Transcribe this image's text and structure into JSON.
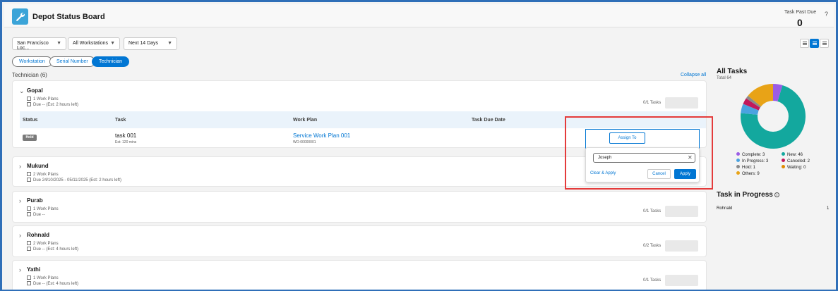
{
  "header": {
    "title": "Depot Status Board",
    "past_due_label": "Task Past Due",
    "past_due_value": "0",
    "help": "?"
  },
  "filters": {
    "location": "San Francisco Loc...",
    "workstation": "All Workstations",
    "range": "Next 14 Days"
  },
  "group_by": [
    {
      "label": "Workstation",
      "active": false
    },
    {
      "label": "Serial Number",
      "active": false
    },
    {
      "label": "Technician",
      "active": true
    }
  ],
  "group_title": "Technician (6)",
  "collapse_all": "Collapse all",
  "technicians": [
    {
      "name": "Gopal",
      "plans": "1 Work Plans",
      "due": "Due -- (Est: 2 hours left)",
      "tasks": "0/1 Tasks"
    },
    {
      "name": "Mukund",
      "plans": "2 Work Plans",
      "due": "Due 24/10/2025 - 05/11/2025 (Est: 2 hours left)",
      "tasks": ""
    },
    {
      "name": "Purab",
      "plans": "1 Work Plans",
      "due": "Due --",
      "tasks": "0/1 Tasks"
    },
    {
      "name": "Rohnald",
      "plans": "2 Work Plans",
      "due": "Due -- (Est: 4 hours left)",
      "tasks": "0/2 Tasks"
    },
    {
      "name": "Yathi",
      "plans": "1 Work Plans",
      "due": "Due -- (Est: 4 hours left)",
      "tasks": "0/1 Tasks"
    }
  ],
  "table": {
    "headers": {
      "status": "Status",
      "task": "Task",
      "work_plan": "Work Plan",
      "due_date": "Task Due Date"
    },
    "row": {
      "status": "Hold",
      "task": "task 001",
      "est": "Est: 120 mins",
      "work_plan": "Service Work Plan 001",
      "work_plan_id": "WO-00000001"
    }
  },
  "assign": {
    "button": "Assign To",
    "input_value": "Joseph",
    "clear_apply": "Clear & Apply",
    "cancel": "Cancel",
    "apply": "Apply"
  },
  "all_tasks": {
    "title": "All Tasks",
    "total": "Total 64",
    "legend": [
      {
        "label": "Complete: 3",
        "color": "#9b5de5"
      },
      {
        "label": "New: 46",
        "color": "#13a89e"
      },
      {
        "label": "In Progress: 3",
        "color": "#4aa3e0"
      },
      {
        "label": "Canceled: 2",
        "color": "#c2185b"
      },
      {
        "label": "Hold: 1",
        "color": "#8a8a8a"
      },
      {
        "label": "Waiting: 0",
        "color": "#e08a00"
      },
      {
        "label": "Others: 9",
        "color": "#e8a317"
      }
    ],
    "slices": [
      {
        "status": "New",
        "value": 46,
        "color": "#13a89e"
      },
      {
        "status": "In Progress",
        "value": 3,
        "color": "#4aa3e0"
      },
      {
        "status": "Canceled",
        "value": 2,
        "color": "#c2185b"
      },
      {
        "status": "Hold",
        "value": 1,
        "color": "#8a8a8a"
      },
      {
        "status": "Others",
        "value": 9,
        "color": "#e8a317"
      },
      {
        "status": "Complete",
        "value": 3,
        "color": "#9b5de5"
      }
    ]
  },
  "in_progress": {
    "title": "Task in Progress",
    "info": "i",
    "rows": [
      {
        "name": "Rohnald",
        "count": "1"
      }
    ]
  }
}
